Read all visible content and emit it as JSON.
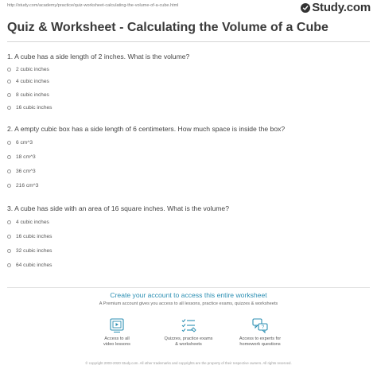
{
  "header": {
    "url": "http://study.com/academy/practice/quiz-worksheet-calculating-the-volume-of-a-cube.html",
    "logo_text": "Study.com"
  },
  "page": {
    "title": "Quiz & Worksheet - Calculating the Volume of a Cube"
  },
  "questions": [
    {
      "text": "1. A cube has a side length of 2 inches. What is the volume?",
      "options": [
        "2 cubic inches",
        "4 cubic inches",
        "8 cubic inches",
        "16 cubic inches"
      ]
    },
    {
      "text": "2. A empty cubic box has a side length of 6 centimeters. How much space is inside the box?",
      "options": [
        "6 cm^3",
        "18 cm^3",
        "36 cm^3",
        "216 cm^3"
      ]
    },
    {
      "text": "3. A cube has side with an area of 16 square inches. What is the volume?",
      "options": [
        "4 cubic inches",
        "16 cubic inches",
        "32 cubic inches",
        "64 cubic inches"
      ]
    }
  ],
  "promo": {
    "title": "Create your account to access this entire worksheet",
    "subtitle": "A Premium account gives you access to all lessons, practice exams, quizzes & worksheets",
    "features": [
      {
        "icon": "video-lessons-icon",
        "line1": "Access to all",
        "line2": "video lessons"
      },
      {
        "icon": "quiz-checklist-icon",
        "line1": "Quizzes, practice exams",
        "line2": "& worksheets"
      },
      {
        "icon": "expert-chat-icon",
        "line1": "Access to experts for",
        "line2": "homework questions"
      }
    ],
    "accent_color": "#2c8fb3"
  },
  "footer": {
    "copyright": "© copyright 2003-2020 Study.com. All other trademarks and copyrights are the property of their respective owners. All rights reserved."
  }
}
